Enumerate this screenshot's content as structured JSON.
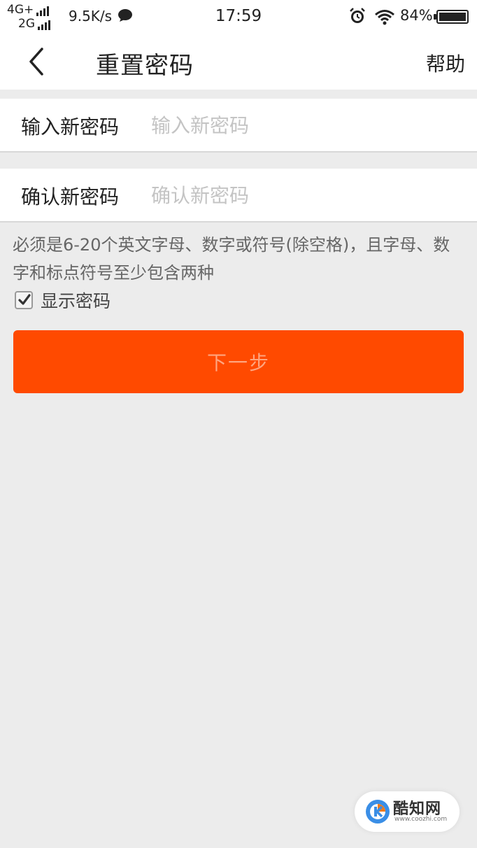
{
  "status_bar": {
    "network_primary": "4G+",
    "network_secondary": "2G",
    "speed": "9.5K/s",
    "time": "17:59",
    "battery": "84%",
    "icons": [
      "signal-icon",
      "chat-icon",
      "alarm-icon",
      "wifi-icon",
      "battery-icon"
    ]
  },
  "header": {
    "back_icon": "chevron-left-icon",
    "title": "重置密码",
    "help": "帮助"
  },
  "form": {
    "new_password": {
      "label": "输入新密码",
      "placeholder": "输入新密码",
      "value": ""
    },
    "confirm_password": {
      "label": "确认新密码",
      "placeholder": "确认新密码",
      "value": ""
    }
  },
  "hint": "必须是6-20个英文字母、数字或符号(除空格)，且字母、数字和标点符号至少包含两种",
  "show_password": {
    "label": "显示密码",
    "checked": true
  },
  "next_button": {
    "label": "下一步"
  },
  "watermark": {
    "name": "酷知网",
    "url": "www.coozhi.com"
  },
  "colors": {
    "accent": "#ff4a00",
    "button_text_disabled": "#ffa57f",
    "page_background": "#ececec",
    "placeholder": "#c4c4c4"
  }
}
